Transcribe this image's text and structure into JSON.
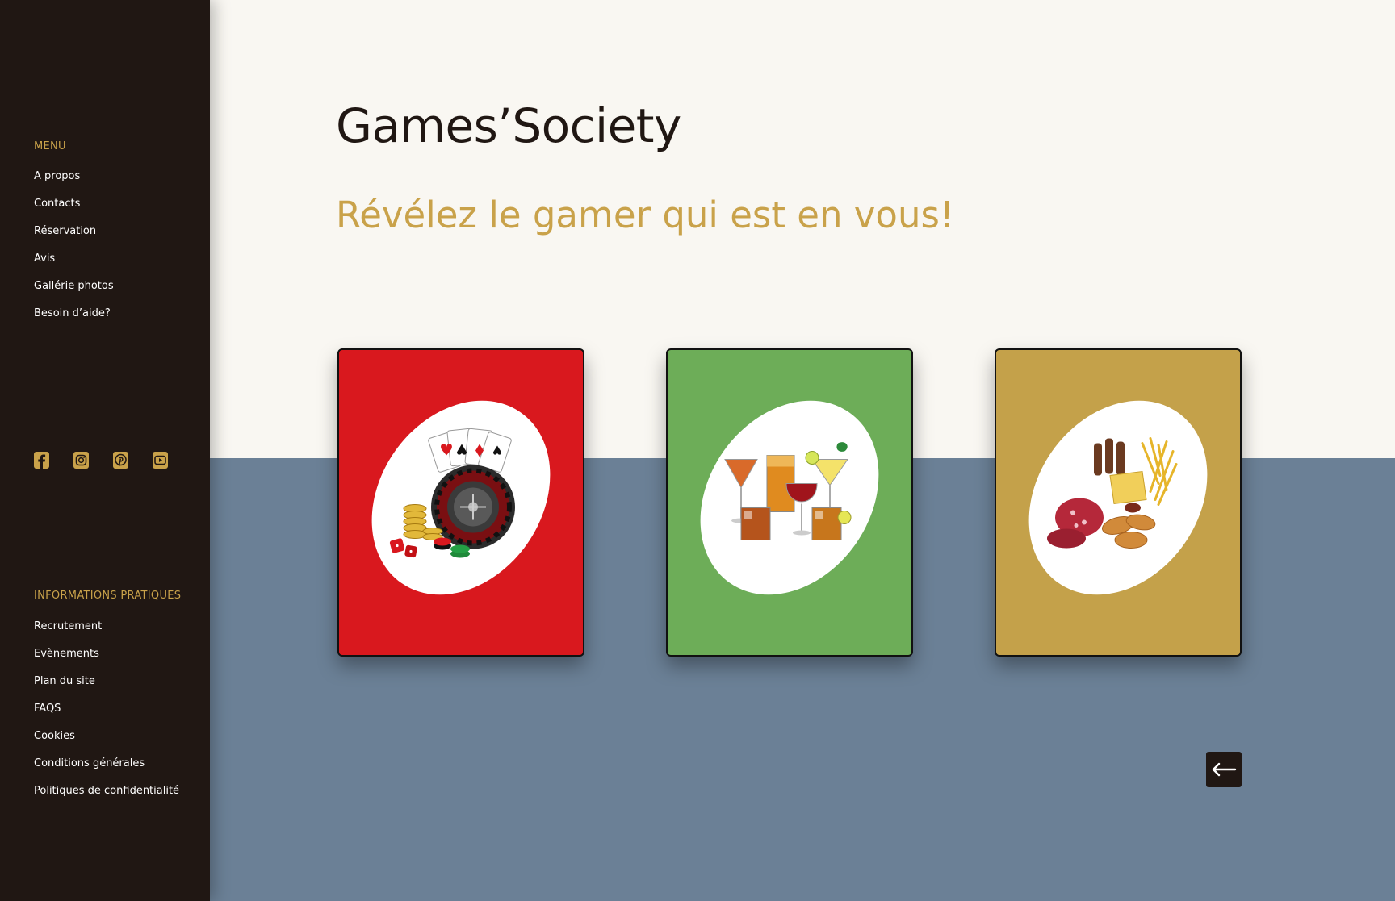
{
  "sidebar": {
    "menu_heading": "MENU",
    "menu_items": [
      {
        "label": "A propos"
      },
      {
        "label": "Contacts"
      },
      {
        "label": "Réservation"
      },
      {
        "label": "Avis"
      },
      {
        "label": "Gallérie photos"
      },
      {
        "label": "Besoin d’aide?"
      }
    ],
    "socials": [
      {
        "icon": "facebook-icon"
      },
      {
        "icon": "instagram-icon"
      },
      {
        "icon": "pinterest-icon"
      },
      {
        "icon": "youtube-icon"
      }
    ],
    "info_heading": "INFORMATIONS PRATIQUES",
    "info_items": [
      {
        "label": "Recrutement"
      },
      {
        "label": "Evènements"
      },
      {
        "label": "Plan du site"
      },
      {
        "label": "FAQS"
      },
      {
        "label": "Cookies"
      },
      {
        "label": "Conditions générales"
      },
      {
        "label": "Politiques de confidentialité"
      }
    ]
  },
  "main": {
    "title": "Games’Society",
    "subtitle": "Révélez le gamer qui est en vous!",
    "cards": [
      {
        "name": "casino-games-card",
        "color": "#d9181e",
        "icon": "casino-roulette-cards-chips-icon"
      },
      {
        "name": "drinks-card",
        "color": "#6dad58",
        "icon": "cocktail-drinks-icon"
      },
      {
        "name": "food-card",
        "color": "#c4a14a",
        "icon": "food-platter-icon"
      }
    ],
    "back_button_icon": "arrow-left-icon"
  },
  "colors": {
    "sidebar_bg": "#201713",
    "accent_gold": "#c9a24a",
    "page_bg": "#f9f7f2",
    "band_blue": "#6b8096"
  }
}
